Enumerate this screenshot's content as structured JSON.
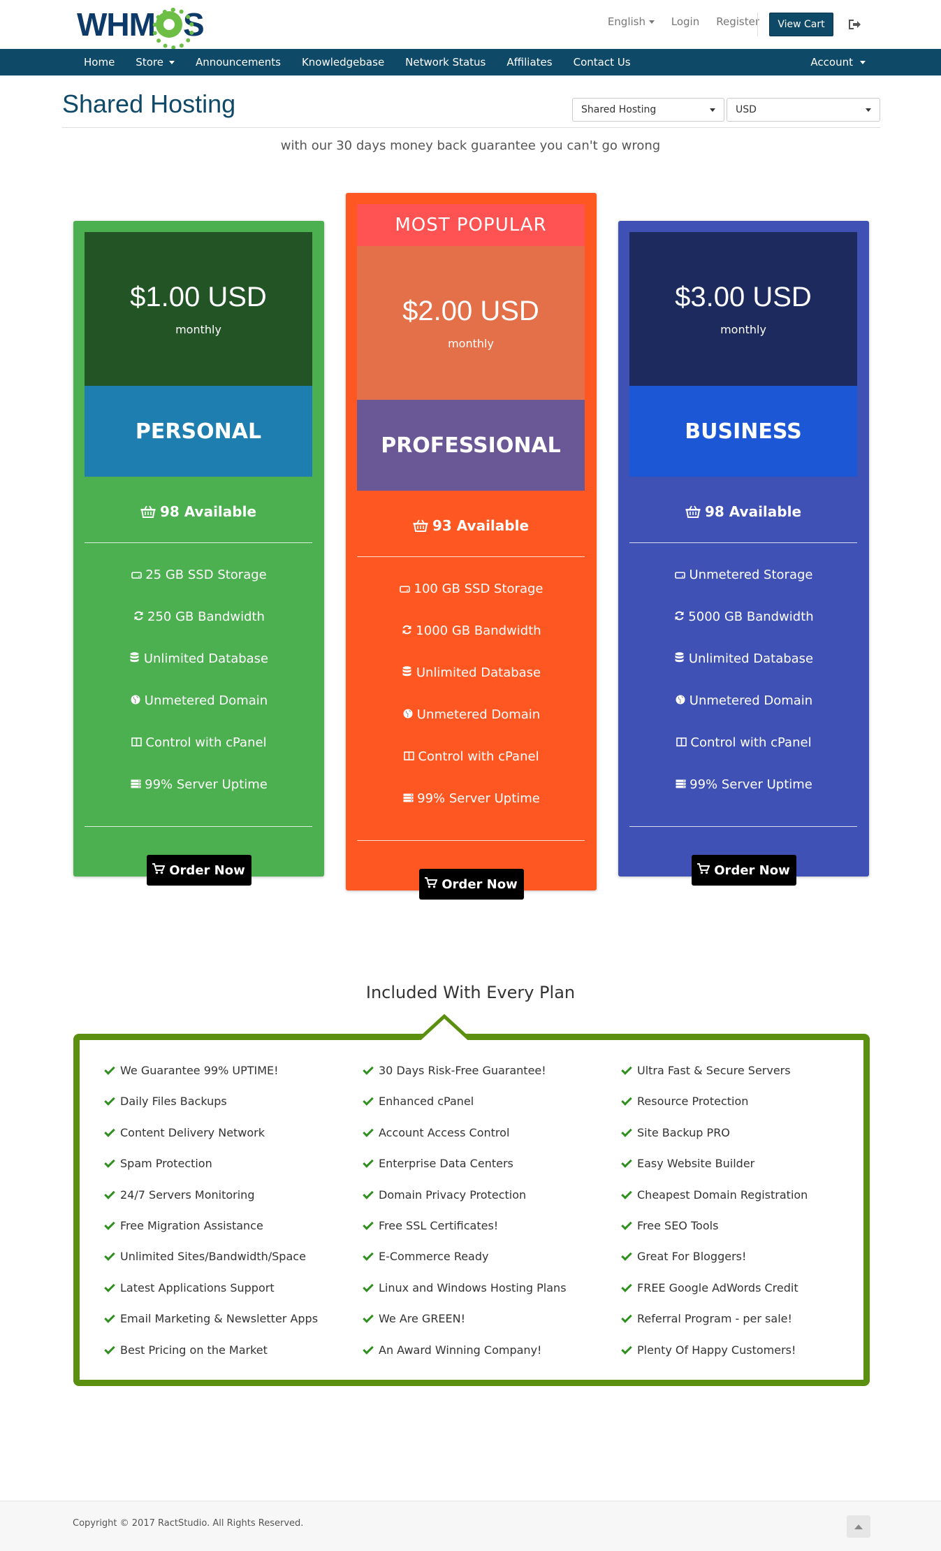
{
  "header": {
    "logo_text": "WHMCS",
    "language": "English",
    "login": "Login",
    "register": "Register",
    "view_cart": "View Cart",
    "logout_icon": "sign-out-icon"
  },
  "nav": {
    "items": [
      "Home",
      "Store",
      "Announcements",
      "Knowledgebase",
      "Network Status",
      "Affiliates",
      "Contact Us"
    ],
    "account": "Account"
  },
  "page": {
    "title": "Shared Hosting",
    "product_group_select": "Shared Hosting",
    "currency_select": "USD",
    "tagline": "with our 30 days money back guarantee you can't go wrong"
  },
  "plans": [
    {
      "price": "$1.00 USD",
      "cycle": "monthly",
      "name": "PERSONAL",
      "available": "98 Available",
      "features": [
        "25 GB SSD Storage",
        "250 GB Bandwidth",
        "Unlimited Database",
        "Unmetered Domain",
        "Control with cPanel",
        "99% Server Uptime"
      ],
      "order": "Order Now",
      "colors": {
        "card": "#4caf50",
        "price_bg": "#235425",
        "name_bg": "#1e7eb0"
      }
    },
    {
      "badge": "MOST POPULAR",
      "price": "$2.00 USD",
      "cycle": "monthly",
      "name": "PROFESSIONAL",
      "available": "93 Available",
      "features": [
        "100 GB SSD Storage",
        "1000 GB Bandwidth",
        "Unlimited Database",
        "Unmetered Domain",
        "Control with cPanel",
        "99% Server Uptime"
      ],
      "order": "Order Now",
      "colors": {
        "card": "#ff5722",
        "price_bg": "#e4704a",
        "name_bg": "#6a5796",
        "badge_bg": "#ff5252"
      }
    },
    {
      "price": "$3.00 USD",
      "cycle": "monthly",
      "name": "BUSINESS",
      "available": "98 Available",
      "features": [
        "Unmetered Storage",
        "5000 GB Bandwidth",
        "Unlimited Database",
        "Unmetered Domain",
        "Control with cPanel",
        "99% Server Uptime"
      ],
      "order": "Order Now",
      "colors": {
        "card": "#3f51b5",
        "price_bg": "#1c2a5e",
        "name_bg": "#1c58d6"
      }
    }
  ],
  "feature_icons": [
    "hdd-icon",
    "refresh-icon",
    "database-icon",
    "globe-icon",
    "columns-icon",
    "server-icon"
  ],
  "included": {
    "title": "Included With Every Plan",
    "columns": [
      [
        "We Guarantee 99% UPTIME!",
        "Daily Files Backups",
        "Content Delivery Network",
        "Spam Protection",
        "24/7 Servers Monitoring",
        "Free Migration Assistance",
        "Unlimited Sites/Bandwidth/Space",
        "Latest Applications Support",
        "Email Marketing & Newsletter Apps",
        "Best Pricing on the Market"
      ],
      [
        "30 Days Risk-Free Guarantee!",
        "Enhanced cPanel",
        "Account Access Control",
        "Enterprise Data Centers",
        "Domain Privacy Protection",
        "Free SSL Certificates!",
        "E-Commerce Ready",
        "Linux and Windows Hosting Plans",
        "We Are GREEN!",
        "An Award Winning Company!"
      ],
      [
        "Ultra Fast & Secure Servers",
        "Resource Protection",
        "Site Backup PRO",
        "Easy Website Builder",
        "Cheapest Domain Registration",
        "Free SEO Tools",
        "Great For Bloggers!",
        "FREE Google AdWords Credit",
        "Referral Program - per sale!",
        "Plenty Of Happy Customers!"
      ]
    ]
  },
  "footer": {
    "copyright": "Copyright © 2017 RactStudio. All Rights Reserved."
  }
}
